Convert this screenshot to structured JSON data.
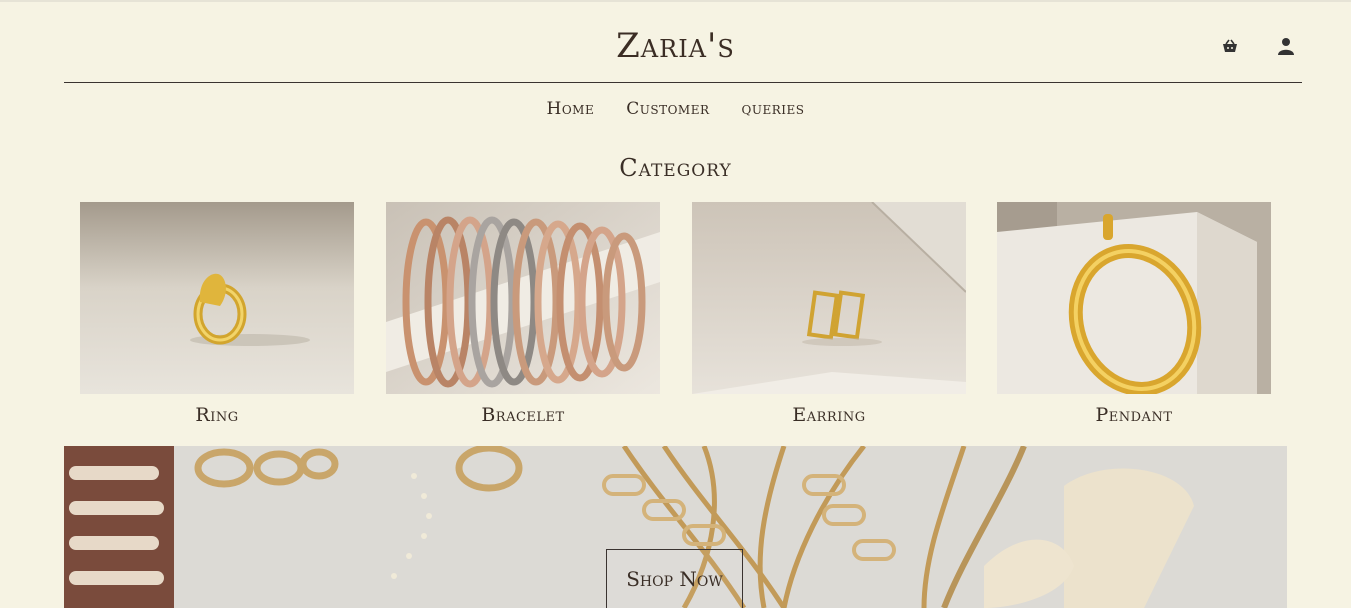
{
  "brand": {
    "name": "Zaria's"
  },
  "header": {
    "icons": [
      "basket-icon",
      "user-icon"
    ]
  },
  "nav": {
    "items": [
      {
        "label": "Home"
      },
      {
        "label": "Customer"
      },
      {
        "label": "queries"
      }
    ]
  },
  "category": {
    "title": "Category",
    "items": [
      {
        "label": "Ring"
      },
      {
        "label": "Bracelet"
      },
      {
        "label": "Earring"
      },
      {
        "label": "Pendant"
      }
    ]
  },
  "banner": {
    "button_label": "Shop Now"
  },
  "colors": {
    "background": "#f6f3e3",
    "text": "#3a2e26",
    "gold": "#d4a63a"
  }
}
